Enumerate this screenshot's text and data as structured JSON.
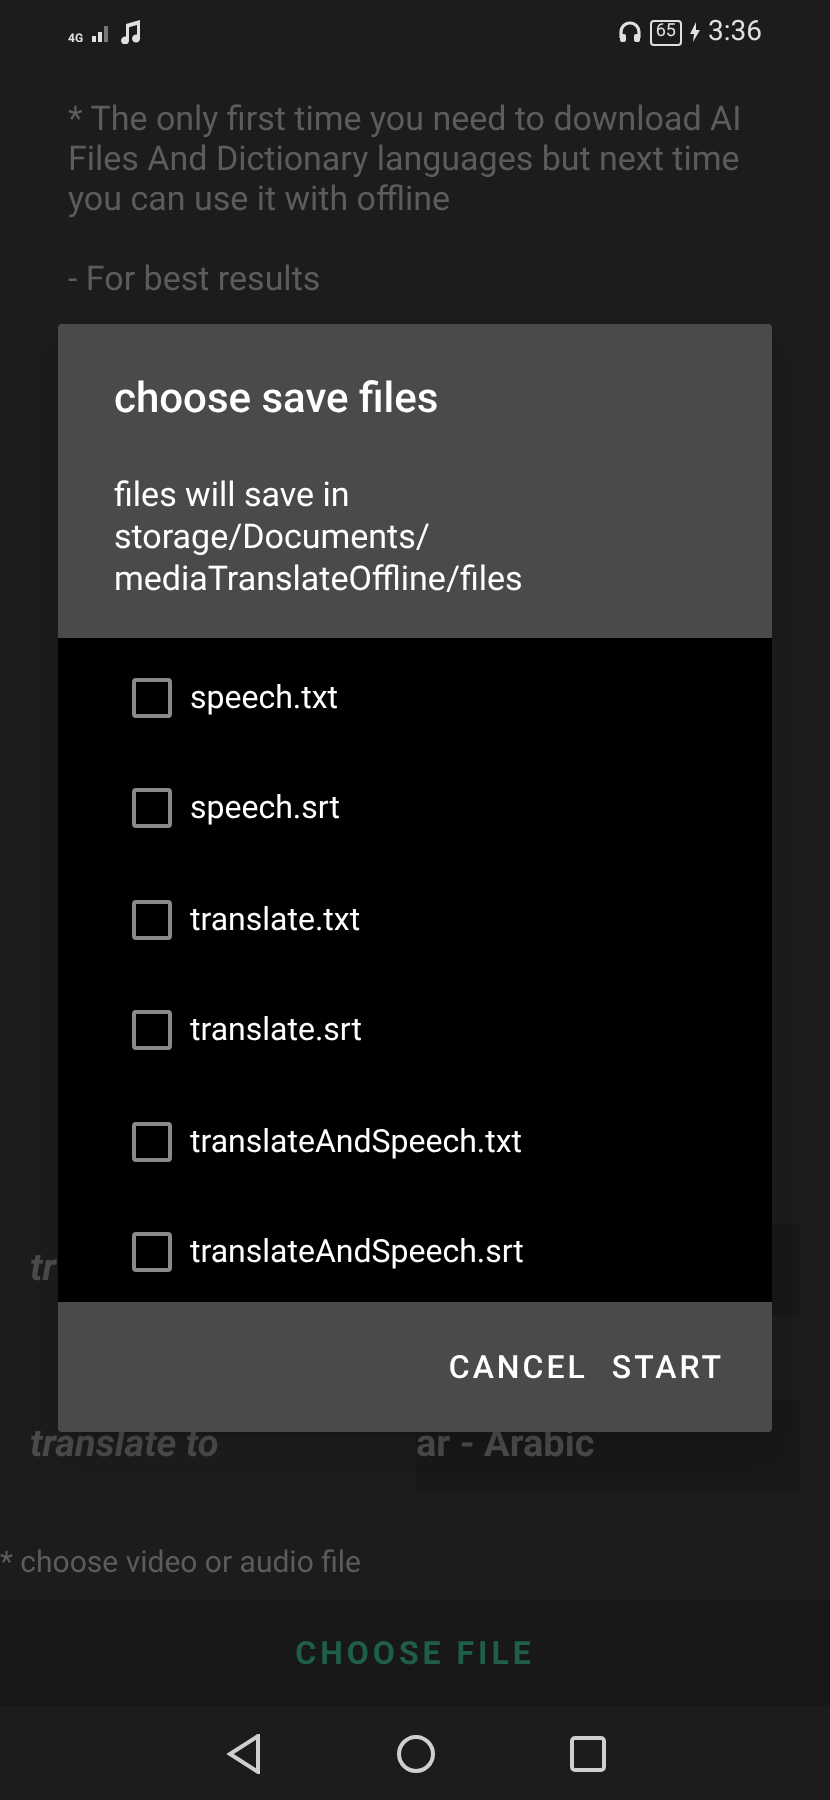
{
  "status_bar": {
    "network": "4G",
    "battery": "65",
    "time": "3:36"
  },
  "info": {
    "lines": [
      "* The only first time you need to download AI Files And Dictionary languages but next time you can use it with offline",
      "- For best results"
    ]
  },
  "language_rows": [
    {
      "label": "tr"
    },
    {
      "label": "translate to",
      "value": "ar - Arabic"
    }
  ],
  "hint": "* choose video or audio file",
  "choose_file_button": "CHOOSE FILE",
  "dialog": {
    "title": "choose save files",
    "message": "files will save in\nstorage/Documents/\nmediaTranslateOffline/files",
    "files": [
      {
        "label": "speech.txt",
        "checked": false
      },
      {
        "label": "speech.srt",
        "checked": false
      },
      {
        "label": "translate.txt",
        "checked": false
      },
      {
        "label": "translate.srt",
        "checked": false
      },
      {
        "label": "translateAndSpeech.txt",
        "checked": false
      },
      {
        "label": "translateAndSpeech.srt",
        "checked": false
      }
    ],
    "buttons": [
      "CANCEL",
      "START"
    ]
  }
}
